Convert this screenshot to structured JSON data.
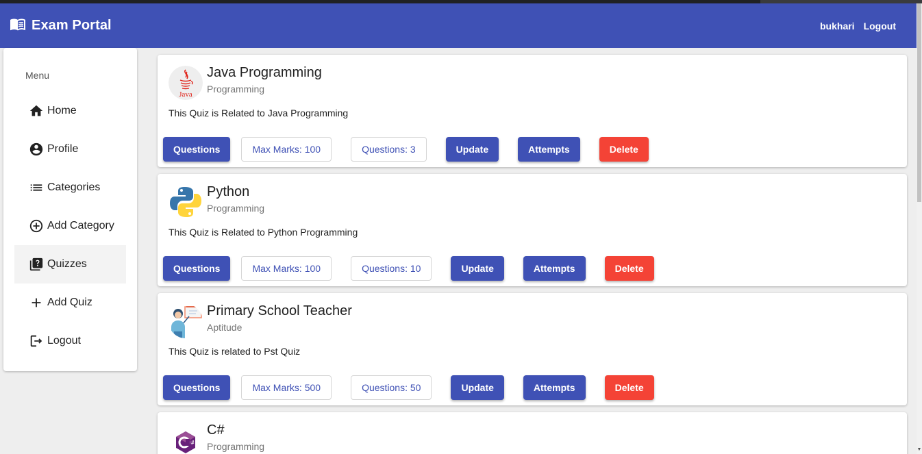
{
  "header": {
    "title": "Exam Portal",
    "username": "bukhari",
    "logout": "Logout"
  },
  "sidebar": {
    "heading": "Menu",
    "items": [
      {
        "label": "Home",
        "icon": "home-icon"
      },
      {
        "label": "Profile",
        "icon": "account-circle-icon"
      },
      {
        "label": "Categories",
        "icon": "list-icon"
      },
      {
        "label": "Add Category",
        "icon": "add-circle-icon"
      },
      {
        "label": "Quizzes",
        "icon": "quiz-icon",
        "active": true
      },
      {
        "label": "Add Quiz",
        "icon": "add-icon"
      },
      {
        "label": "Logout",
        "icon": "logout-icon"
      }
    ]
  },
  "quizzes": [
    {
      "title": "Java Programming",
      "category": "Programming",
      "description": "This Quiz is Related to Java Programming",
      "questions_button": "Questions",
      "max_marks": "Max Marks: 100",
      "question_count": "Questions: 3",
      "update": "Update",
      "attempts": "Attempts",
      "delete": "Delete",
      "icon": "java-logo-icon",
      "icon_text": "Java"
    },
    {
      "title": "Python",
      "category": "Programming",
      "description": "This Quiz is Related to Python Programming",
      "questions_button": "Questions",
      "max_marks": "Max Marks: 100",
      "question_count": "Questions: 10",
      "update": "Update",
      "attempts": "Attempts",
      "delete": "Delete",
      "icon": "python-logo-icon"
    },
    {
      "title": "Primary School Teacher",
      "category": "Aptitude",
      "description": "This Quiz is related to Pst Quiz",
      "questions_button": "Questions",
      "max_marks": "Max Marks: 500",
      "question_count": "Questions: 50",
      "update": "Update",
      "attempts": "Attempts",
      "delete": "Delete",
      "icon": "teacher-icon"
    },
    {
      "title": "C#",
      "category": "Programming",
      "icon": "csharp-logo-icon"
    }
  ],
  "colors": {
    "primary": "#3f51b5",
    "warn": "#f44336",
    "background": "#eeeeee"
  }
}
